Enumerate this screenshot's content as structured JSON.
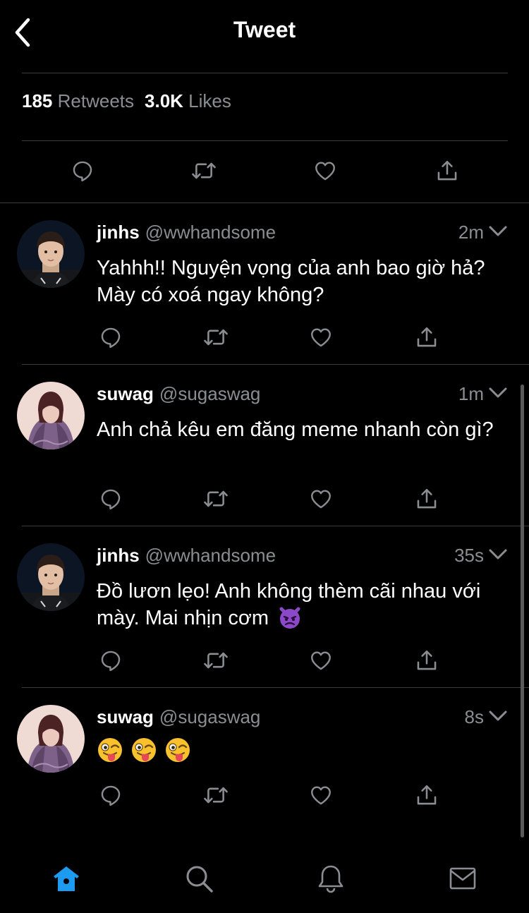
{
  "header": {
    "title": "Tweet",
    "back_icon": "chevron-left-icon"
  },
  "stats": {
    "retweets_count": "185",
    "retweets_label": "Retweets",
    "likes_count": "3.0K",
    "likes_label": "Likes"
  },
  "actions": [
    "reply-icon",
    "retweet-icon",
    "like-icon",
    "share-icon"
  ],
  "replies": [
    {
      "name": "jinhs",
      "handle": "@wwhandsome",
      "time": "2m",
      "text": "Yahhh!! Nguyện vọng của anh bao giờ hả? Mày có xoá ngay không?"
    },
    {
      "name": "suwag",
      "handle": "@sugaswag",
      "time": "1m",
      "text": "Anh chả kêu em đăng meme nhanh còn gì?"
    },
    {
      "name": "jinhs",
      "handle": "@wwhandsome",
      "time": "35s",
      "text": "Đồ lươn lẹo! Anh không thèm cãi nhau với mày. Mai nhịn cơm",
      "emoji": "angry-devil-emoji"
    },
    {
      "name": "suwag",
      "handle": "@sugaswag",
      "time": "8s",
      "text": "",
      "emoji": [
        "winking-tongue-emoji",
        "winking-tongue-emoji",
        "winking-tongue-emoji"
      ]
    }
  ],
  "tabbar": [
    "home-icon",
    "search-icon",
    "notifications-icon",
    "messages-icon"
  ],
  "colors": {
    "background": "#000000",
    "text": "#ffffff",
    "secondary_text": "#8a8d91",
    "icon": "#8a8d91",
    "accent": "#1d9bf0",
    "divider": "#3d3d3d"
  }
}
